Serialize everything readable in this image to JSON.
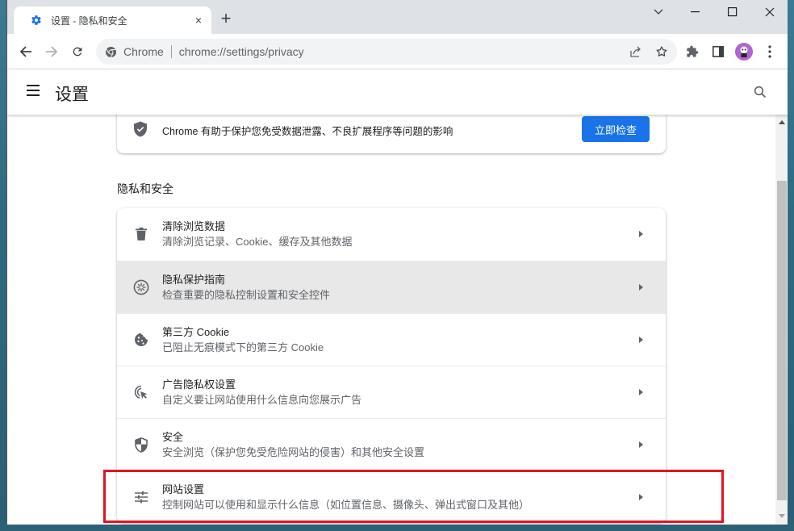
{
  "browser": {
    "tab": {
      "title": "设置 - 隐私和安全",
      "close_label": "×"
    },
    "new_tab_label": "+",
    "window_controls": {
      "tab_search": "tab-search",
      "minimize": "minimize",
      "maximize": "maximize",
      "close": "close"
    },
    "omnibox": {
      "site_label": "Chrome",
      "url": "chrome://settings/privacy"
    }
  },
  "settings": {
    "title": "设置",
    "safety_check": {
      "text": "Chrome 有助于保护您免受数据泄露、不良扩展程序等问题的影响",
      "button_label": "立即检查"
    },
    "section_title": "隐私和安全",
    "items": [
      {
        "icon": "trash-icon",
        "label": "清除浏览数据",
        "sub": "清除浏览记录、Cookie、缓存及其他数据"
      },
      {
        "icon": "privacy-guide-icon",
        "label": "隐私保护指南",
        "sub": "检查重要的隐私控制设置和安全控件"
      },
      {
        "icon": "cookie-icon",
        "label": "第三方 Cookie",
        "sub": "已阻止无痕模式下的第三方 Cookie"
      },
      {
        "icon": "ad-privacy-icon",
        "label": "广告隐私权设置",
        "sub": "自定义要让网站使用什么信息向您展示广告"
      },
      {
        "icon": "security-shield-icon",
        "label": "安全",
        "sub": "安全浏览（保护您免受危险网站的侵害）和其他安全设置"
      },
      {
        "icon": "tune-icon",
        "label": "网站设置",
        "sub": "控制网站可以使用和显示什么信息（如位置信息、摄像头、弹出式窗口及其他）"
      }
    ]
  },
  "colors": {
    "accent": "#1a73e8",
    "highlight": "#e3141f",
    "hover_row": "#e8e8e8"
  }
}
